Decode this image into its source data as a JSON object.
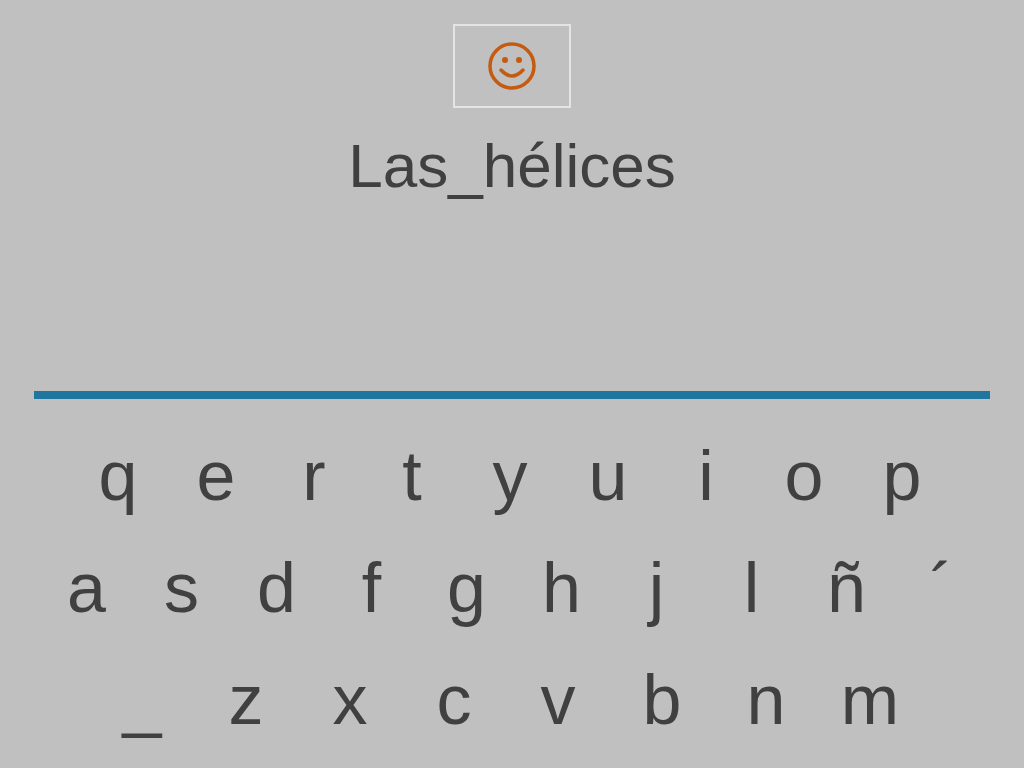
{
  "word": "Las_hélices",
  "keyboard": {
    "rows": [
      {
        "keys": [
          "q",
          "e",
          "r",
          "t",
          "y",
          "u",
          "i",
          "o",
          "p"
        ]
      },
      {
        "keys": [
          "a",
          "s",
          "d",
          "f",
          "g",
          "h",
          "j",
          "l",
          "ñ",
          "´"
        ]
      },
      {
        "keys": [
          "_",
          "z",
          "x",
          "c",
          "v",
          "b",
          "n",
          "m"
        ]
      }
    ]
  }
}
